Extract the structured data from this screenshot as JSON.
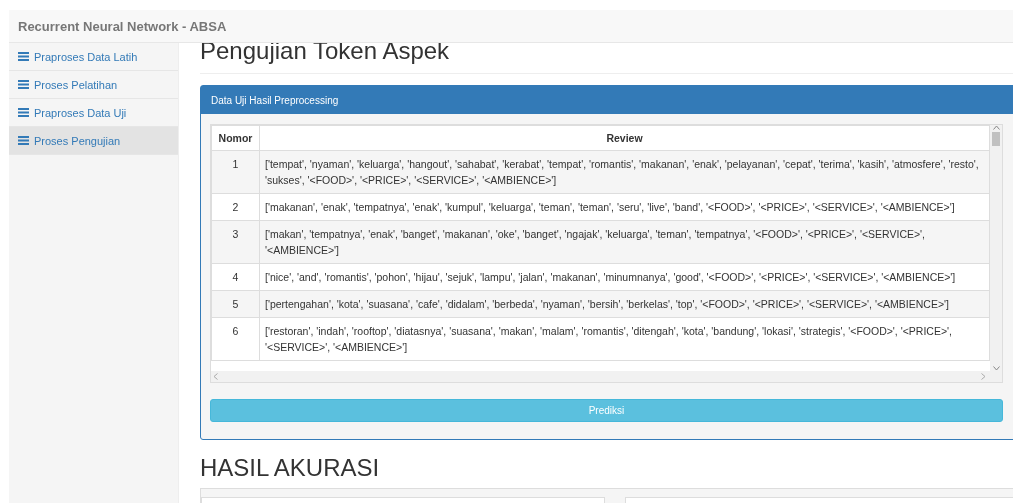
{
  "navbar": {
    "title": "Recurrent Neural Network - ABSA"
  },
  "sidebar": {
    "items": [
      {
        "label": "Praproses Data Latih",
        "selected": false
      },
      {
        "label": "Proses Pelatihan",
        "selected": false
      },
      {
        "label": "Praproses Data Uji",
        "selected": false
      },
      {
        "label": "Proses Pengujian",
        "selected": true
      }
    ]
  },
  "page_title": "Pengujian Token Aspek",
  "panel": {
    "title": "Data Uji Hasil Preprocessing",
    "table": {
      "columns": [
        "Nomor",
        "Review"
      ],
      "rows": [
        [
          "1",
          "['tempat', 'nyaman', 'keluarga', 'hangout', 'sahabat', 'kerabat', 'tempat', 'romantis', 'makanan', 'enak', 'pelayanan', 'cepat', 'terima', 'kasih', 'atmosfere', 'resto', 'sukses', '<FOOD>', '<PRICE>', '<SERVICE>', '<AMBIENCE>']"
        ],
        [
          "2",
          "['makanan', 'enak', 'tempatnya', 'enak', 'kumpul', 'keluarga', 'teman', 'teman', 'seru', 'live', 'band', '<FOOD>', '<PRICE>', '<SERVICE>', '<AMBIENCE>']"
        ],
        [
          "3",
          "['makan', 'tempatnya', 'enak', 'banget', 'makanan', 'oke', 'banget', 'ngajak', 'keluarga', 'teman', 'tempatnya', '<FOOD>', '<PRICE>', '<SERVICE>', '<AMBIENCE>']"
        ],
        [
          "4",
          "['nice', 'and', 'romantis', 'pohon', 'hijau', 'sejuk', 'lampu', 'jalan', 'makanan', 'minumnanya', 'good', '<FOOD>', '<PRICE>', '<SERVICE>', '<AMBIENCE>']"
        ],
        [
          "5",
          "['pertengahan', 'kota', 'suasana', 'cafe', 'didalam', 'berbeda', 'nyaman', 'bersih', 'berkelas', 'top', '<FOOD>', '<PRICE>', '<SERVICE>', '<AMBIENCE>']"
        ],
        [
          "6",
          "['restoran', 'indah', 'rooftop', 'diatasnya', 'suasana', 'makan', 'malam', 'romantis', 'ditengah', 'kota', 'bandung', 'lokasi', 'strategis', '<FOOD>', '<PRICE>', '<SERVICE>', '<AMBIENCE>']"
        ]
      ]
    },
    "button": "Prediksi"
  },
  "section_title": "HASIL AKURASI"
}
